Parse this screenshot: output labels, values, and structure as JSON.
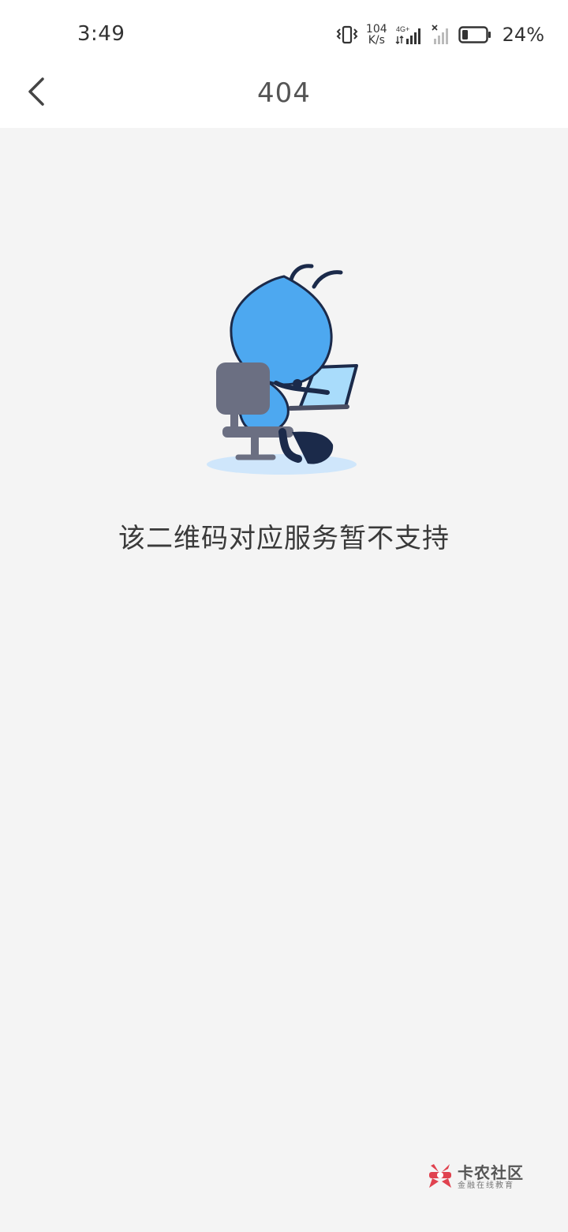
{
  "status_bar": {
    "time": "3:49",
    "net_speed_value": "104",
    "net_speed_unit": "K/s",
    "network_type": "4G+",
    "battery_percent": "24%",
    "battery_level": 0.24,
    "icons": [
      "vibrate-icon",
      "signal-4g-icon",
      "signal-no-sim-icon",
      "battery-icon"
    ]
  },
  "nav": {
    "title": "404",
    "back_icon": "chevron-left-icon"
  },
  "main": {
    "illustration": "ant-mascot-at-computer",
    "message": "该二维码对应服务暂不支持"
  },
  "watermark": {
    "title": "卡农社区",
    "subtitle": "金融在线教育"
  },
  "colors": {
    "background": "#f4f4f4",
    "bar_background": "#ffffff",
    "mascot_blue": "#4da8f0",
    "outline": "#1b2a4a",
    "chair": "#6b6f82",
    "shadow": "#cfe6fb",
    "watermark_red": "#e0424f"
  }
}
